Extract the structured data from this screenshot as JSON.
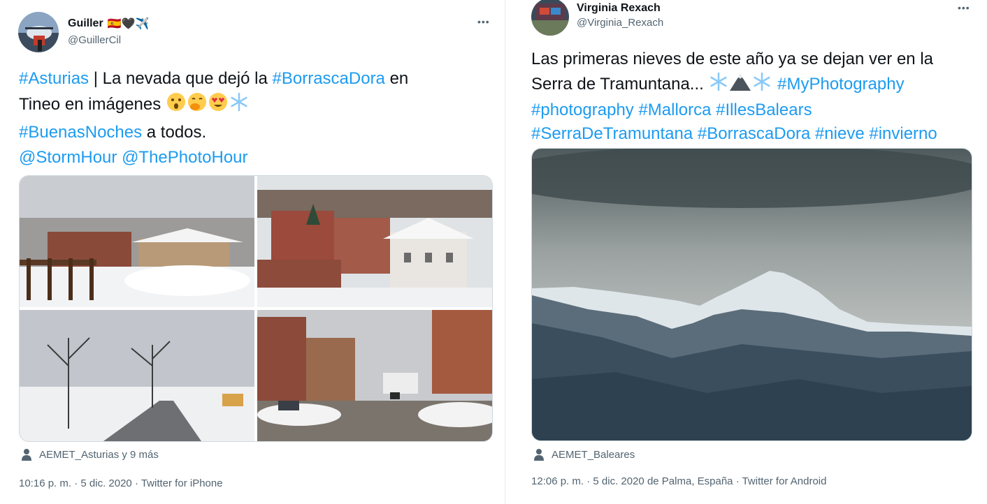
{
  "left": {
    "name": "Guiller",
    "name_emoji": "🇪🇸🖤✈️",
    "handle": "@GuillerCil",
    "more_icon": "more-dots-icon",
    "text": {
      "l1_tag1": "#Asturias",
      "l1_mid": " | La nevada que dejó la ",
      "l1_tag2": "#BorrascaDora",
      "l1_end": " en",
      "l2": "Tineo en imágenes ",
      "l3_tag": "#BuenasNoches",
      "l3_end": " a todos.",
      "l4_m1": "@StormHour",
      "l4_sp": " ",
      "l4_m2": "@ThePhotoHour"
    },
    "tagged": "AEMET_Asturias y 9 más",
    "meta": {
      "time": "10:16 p. m.",
      "sep1": " · ",
      "date": "5 dic. 2020",
      "sep2": " · ",
      "source": "Twitter for iPhone"
    }
  },
  "right": {
    "name": "Virginia Rexach",
    "handle": "@Virginia_Rexach",
    "more_icon": "more-dots-icon",
    "text": {
      "l1": "Las primeras nieves de este año ya se dejan ver en la",
      "l2_start": "Serra de Tramuntana... ",
      "l2_tag": "#MyPhotography",
      "l3": "#photography #Mallorca #IllesBalears",
      "l4": "#SerraDeTramuntana #BorrascaDora #nieve #invierno"
    },
    "tagged": "AEMET_Baleares",
    "meta": {
      "time": "12:06 p. m.",
      "sep1": " · ",
      "date": "5 dic. 2020 de Palma, España",
      "sep2": " · ",
      "source": "Twitter for Android"
    }
  },
  "colors": {
    "link": "#1d9bf0",
    "secondary": "#536471",
    "text": "#0f1419"
  }
}
